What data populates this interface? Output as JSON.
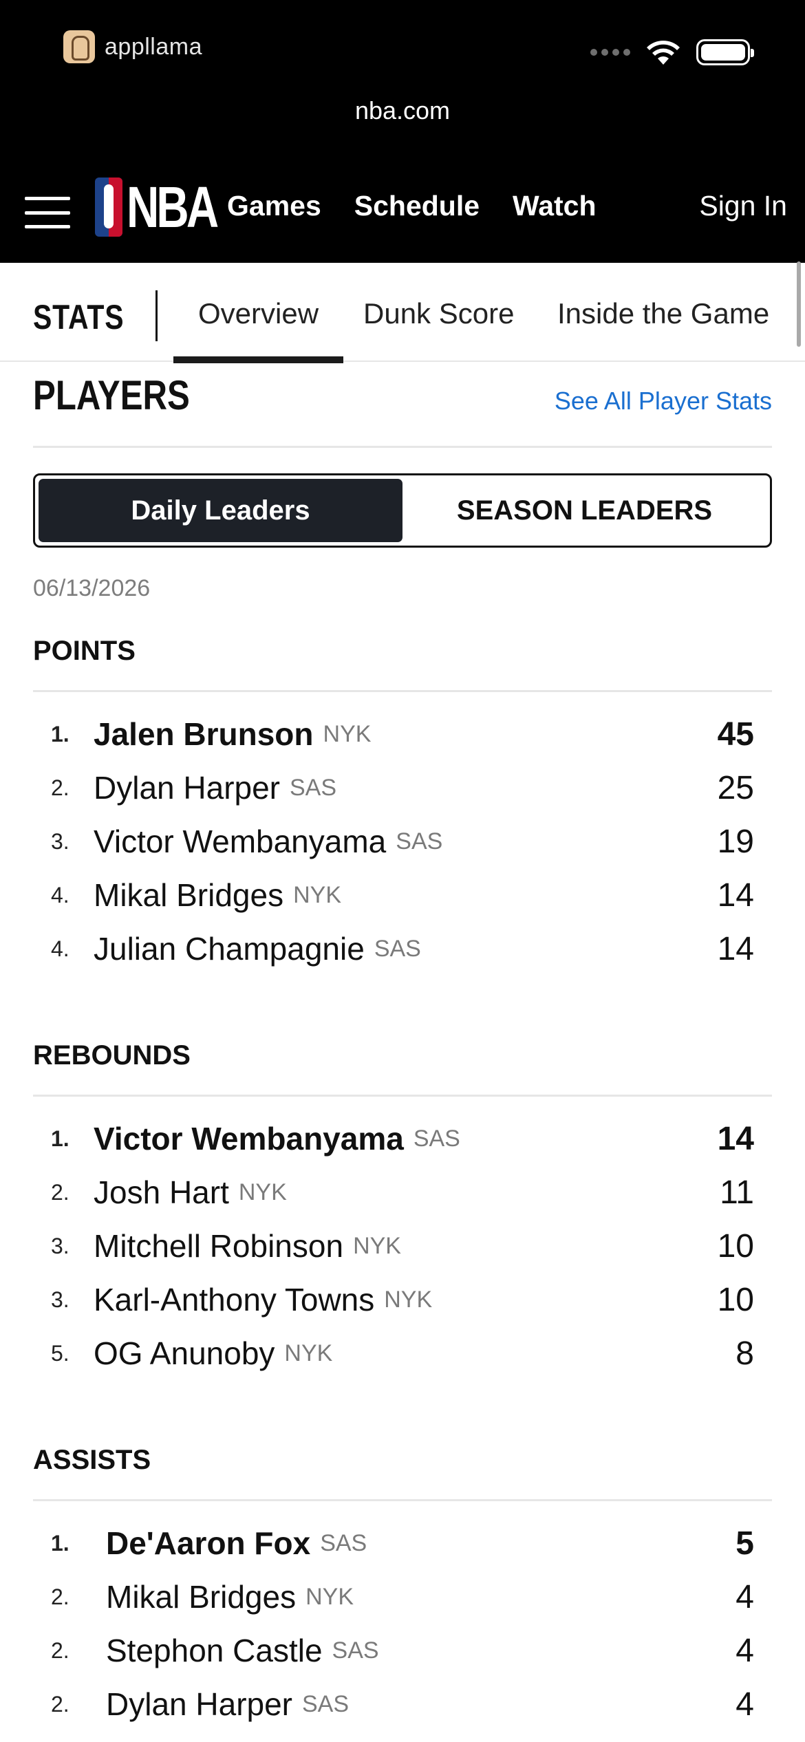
{
  "status_bar": {
    "app_name": "appllama",
    "url": "nba.com"
  },
  "nav": {
    "links": [
      "Games",
      "Schedule",
      "Watch"
    ],
    "sign_in": "Sign In"
  },
  "subnav": {
    "label": "STATS",
    "tabs": [
      "Overview",
      "Dunk Score",
      "Inside the Game"
    ],
    "active_tab": "Overview"
  },
  "players": {
    "title": "PLAYERS",
    "see_all": "See All Player Stats",
    "toggle": {
      "daily": "Daily Leaders",
      "season": "SEASON LEADERS",
      "selected": "Daily Leaders"
    },
    "date": "06/13/2026",
    "categories": [
      {
        "title": "POINTS",
        "rows": [
          {
            "rank": "1.",
            "name": "Jalen Brunson",
            "team": "NYK",
            "value": "45"
          },
          {
            "rank": "2.",
            "name": "Dylan Harper",
            "team": "SAS",
            "value": "25"
          },
          {
            "rank": "3.",
            "name": "Victor Wembanyama",
            "team": "SAS",
            "value": "19"
          },
          {
            "rank": "4.",
            "name": "Mikal Bridges",
            "team": "NYK",
            "value": "14"
          },
          {
            "rank": "4.",
            "name": "Julian Champagnie",
            "team": "SAS",
            "value": "14"
          }
        ]
      },
      {
        "title": "REBOUNDS",
        "rows": [
          {
            "rank": "1.",
            "name": "Victor Wembanyama",
            "team": "SAS",
            "value": "14"
          },
          {
            "rank": "2.",
            "name": "Josh Hart",
            "team": "NYK",
            "value": "11"
          },
          {
            "rank": "3.",
            "name": "Mitchell Robinson",
            "team": "NYK",
            "value": "10"
          },
          {
            "rank": "3.",
            "name": "Karl-Anthony Towns",
            "team": "NYK",
            "value": "10"
          },
          {
            "rank": "5.",
            "name": "OG Anunoby",
            "team": "NYK",
            "value": "8"
          }
        ]
      },
      {
        "title": "ASSISTS",
        "rows": [
          {
            "rank": "1.",
            "name": "De'Aaron Fox",
            "team": "SAS",
            "value": "5"
          },
          {
            "rank": "2.",
            "name": "Mikal Bridges",
            "team": "NYK",
            "value": "4"
          },
          {
            "rank": "2.",
            "name": "Stephon Castle",
            "team": "SAS",
            "value": "4"
          },
          {
            "rank": "2.",
            "name": "Dylan Harper",
            "team": "SAS",
            "value": "4"
          }
        ]
      }
    ]
  }
}
